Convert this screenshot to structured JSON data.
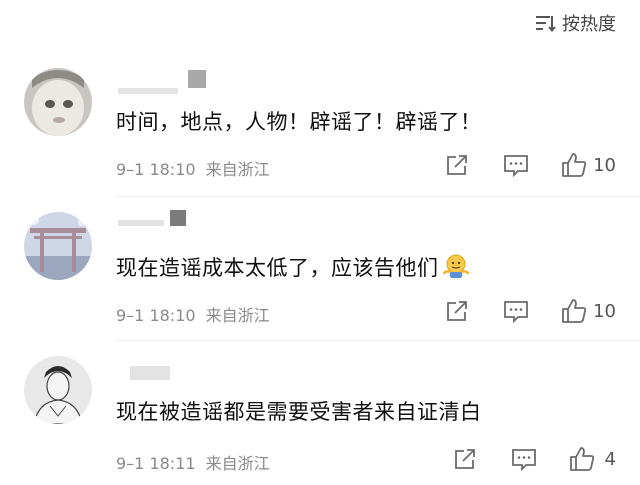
{
  "sort": {
    "label": "按热度",
    "icon": "sort-lines-icon"
  },
  "comments": [
    {
      "text": "时间，地点，人物！辟谣了！辟谣了！",
      "date": "9–1 18:10",
      "location": "来自浙江",
      "likes": "10",
      "avatar": "baby-photo-avatar"
    },
    {
      "text": "现在造谣成本太低了，应该告他们",
      "emoji": "shrug-emoji",
      "date": "9–1 18:10",
      "location": "来自浙江",
      "likes": "10",
      "avatar": "torii-gate-avatar"
    },
    {
      "text": "现在被造谣都是需要受害者来自证清白",
      "date": "9–1 18:11",
      "location": "来自浙江",
      "likes": "4",
      "avatar": "sketch-portrait-avatar"
    }
  ],
  "colors": {
    "text": "#111111",
    "meta": "#8a8a8a",
    "icon": "#6b6b6b",
    "divider": "#ececec"
  }
}
